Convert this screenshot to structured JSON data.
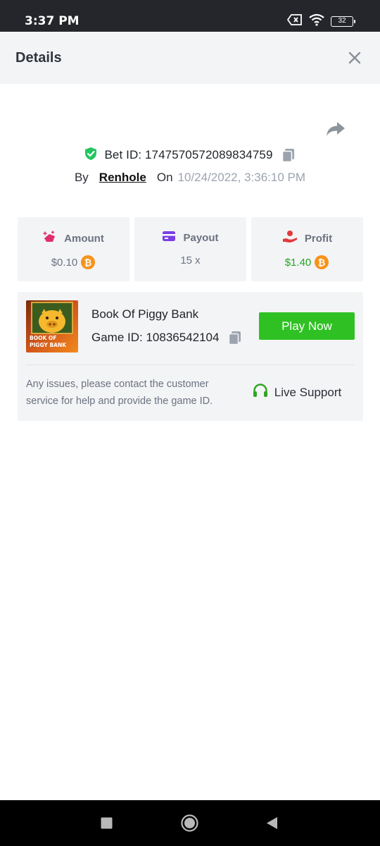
{
  "status_bar": {
    "time": "3:37 PM",
    "battery": "32"
  },
  "header": {
    "title": "Details"
  },
  "bet": {
    "id_label": "Bet ID: 1747570572089834759",
    "by_label": "By",
    "user": "Renhole",
    "on_label": "On",
    "date": "10/24/2022, 3:36:10 PM"
  },
  "stats": {
    "amount": {
      "label": "Amount",
      "value": "$0.10"
    },
    "payout": {
      "label": "Payout",
      "value": "15 x"
    },
    "profit": {
      "label": "Profit",
      "value": "$1.40"
    }
  },
  "game": {
    "name": "Book Of Piggy Bank",
    "id_label": "Game ID: 10836542104",
    "thumb_text_line1": "BOOK OF",
    "thumb_text_line2": "PIGGY BANK",
    "play_label": "Play Now",
    "help_text": "Any issues, please contact the customer service for help and provide the game ID.",
    "support_label": "Live Support"
  },
  "colors": {
    "accent_green": "#2fc123",
    "profit_green": "#22a61f",
    "shield_green": "#22c55e",
    "amount_pink": "#e0306b",
    "payout_purple": "#7b3fe4",
    "profit_red": "#e23a3a",
    "coin_orange": "#f7931a"
  },
  "icons": {
    "close": "close-icon",
    "share": "share-icon",
    "copy": "copy-icon",
    "shield": "shield-check-icon",
    "headset": "headset-icon"
  }
}
